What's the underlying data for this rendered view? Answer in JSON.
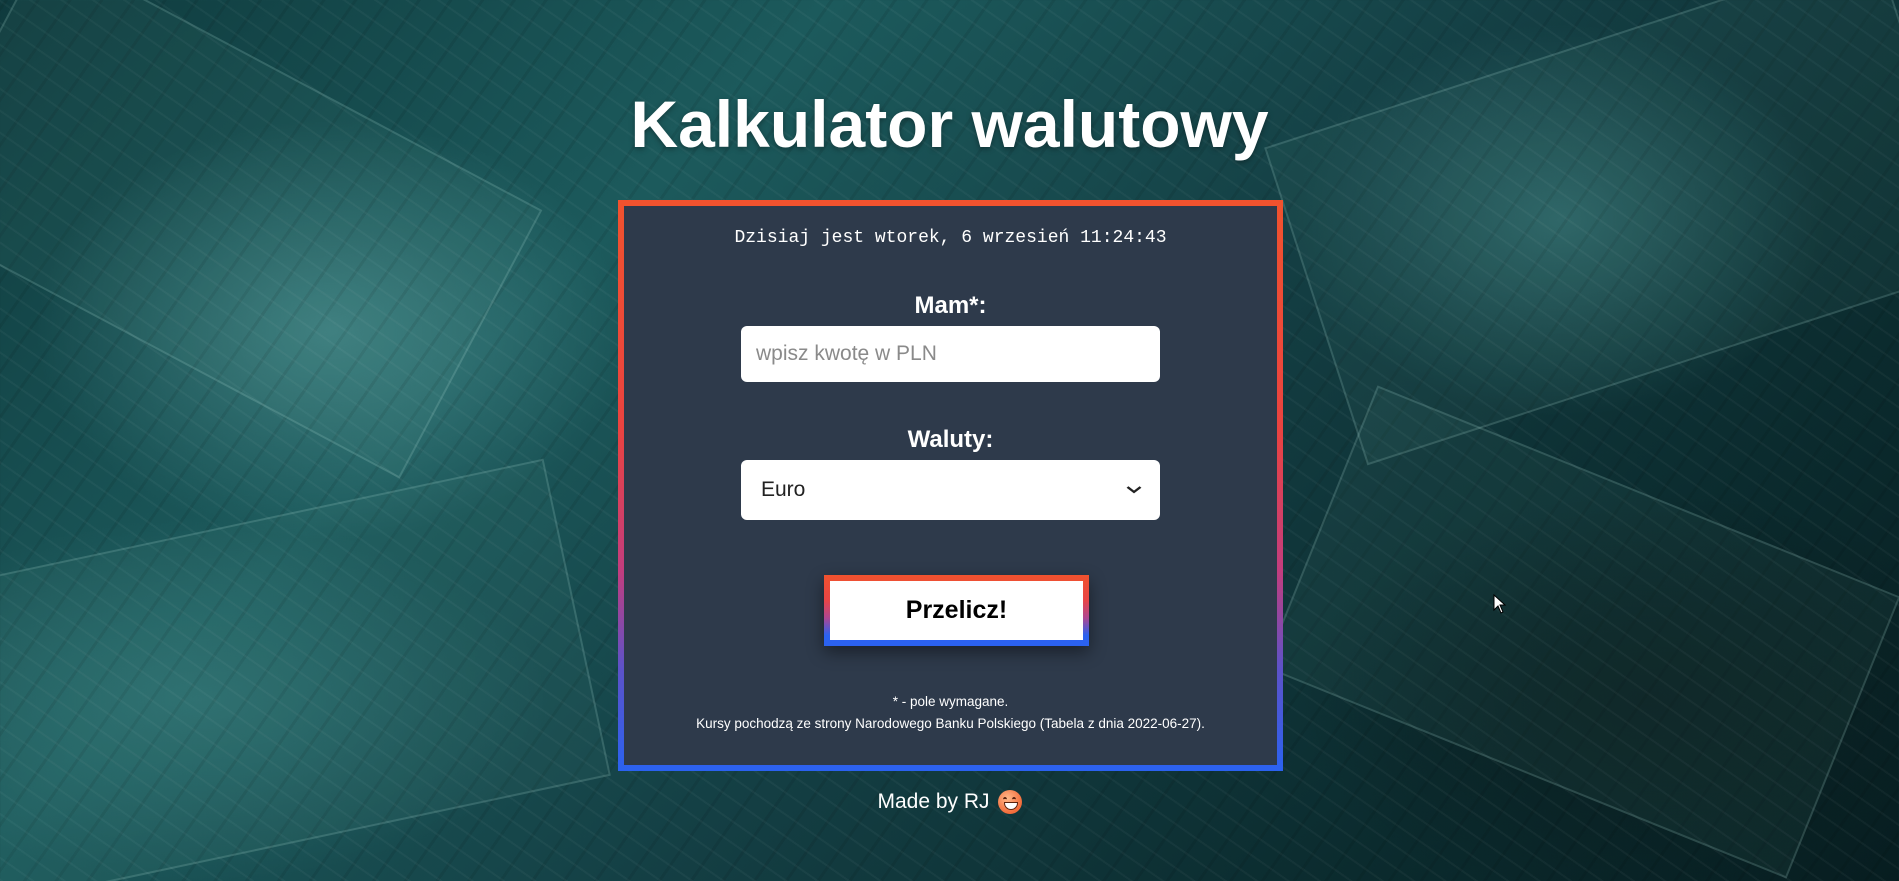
{
  "header": {
    "title": "Kalkulator walutowy"
  },
  "card": {
    "date_line": "Dzisiaj jest wtorek, 6 wrzesień 11:24:43",
    "amount": {
      "label": "Mam*:",
      "value": "",
      "placeholder": "wpisz kwotę w PLN"
    },
    "currency": {
      "label": "Waluty:",
      "selected": "Euro"
    },
    "submit_label": "Przelicz!",
    "note_required": "* - pole wymagane.",
    "note_source": "Kursy pochodzą ze strony Narodowego Banku Polskiego (Tabela z dnia 2022-06-27)."
  },
  "footer": {
    "text": "Made by RJ",
    "icon": "grinning-face-icon"
  },
  "colors": {
    "card_background": "#2e3a4b",
    "border_gradient_top": "#f0522e",
    "border_gradient_bottom": "#2b62f0"
  }
}
